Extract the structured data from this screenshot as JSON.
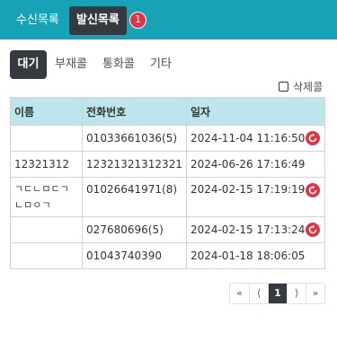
{
  "top_tabs": {
    "inbox": "수신목록",
    "outbox": "발신목록",
    "badge": "1"
  },
  "sub_tabs": [
    "대기",
    "부재콜",
    "통화콜",
    "기타"
  ],
  "delete_call_label": "삭제콜",
  "table": {
    "headers": [
      "이름",
      "전화번호",
      "일자"
    ],
    "rows": [
      {
        "name": "",
        "phone": "01033661036(5)",
        "date": "2024-11-04 11:16:50",
        "retry_icon": true
      },
      {
        "name": "12321312",
        "phone": "12321321312321",
        "date": "2024-06-26 17:16:49",
        "retry_icon": false
      },
      {
        "name": "ㄱㄷㄴㅁㄷㄱ ㄴㅁㅇㄱ",
        "phone": "01026641971(8)",
        "date": "2024-02-15 17:19:19",
        "retry_icon": true
      },
      {
        "name": "",
        "phone": "027680696(5)",
        "date": "2024-02-15 17:13:24",
        "retry_icon": true
      },
      {
        "name": "",
        "phone": "01043740390",
        "date": "2024-01-18 18:06:05",
        "retry_icon": false
      }
    ]
  },
  "pagination": {
    "first": "«",
    "prev": "⟨",
    "current": "1",
    "next": "⟩",
    "last": "»"
  },
  "colors": {
    "accent": "#17a2b8",
    "dark": "#343a40",
    "badge": "#dc3545",
    "header_bg": "#bee5eb"
  }
}
